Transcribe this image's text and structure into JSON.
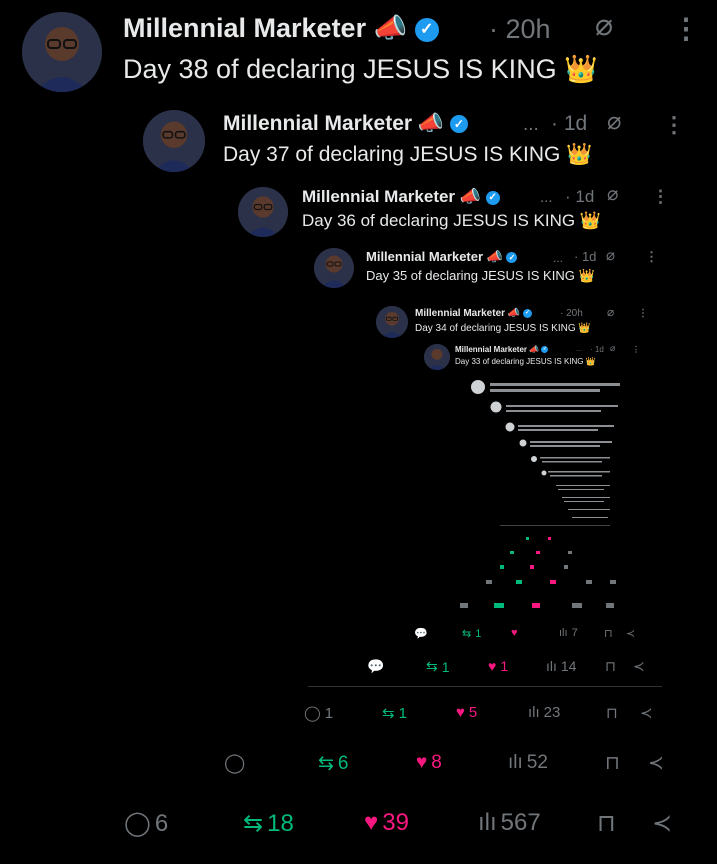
{
  "posts": [
    {
      "name": "Millennial Marketer",
      "time": "· 20h",
      "text": "Day 38 of declaring JESUS IS KING",
      "more": "⋮"
    },
    {
      "name": "Millennial Marketer",
      "ellipsis": "...",
      "time": "· 1d",
      "text": "Day 37 of declaring JESUS IS KING",
      "more": "⋮"
    },
    {
      "name": "Millennial Marketer",
      "ellipsis": "...",
      "time": "· 1d",
      "text": "Day 36 of declaring JESUS IS KING",
      "more": "⋮"
    },
    {
      "name": "Millennial Marketer",
      "ellipsis": "...",
      "time": "· 1d",
      "text": "Day 35 of declaring JESUS IS KING",
      "more": "⋮"
    },
    {
      "name": "Millennial Marketer",
      "time": "· 20h",
      "text": "Day 34 of declaring JESUS IS KING",
      "more": "⋮"
    },
    {
      "name": "Millennial Marketer",
      "ellipsis": "...",
      "time": "· 1d",
      "text": "Day 33 of declaring JESUS IS KING",
      "more": "⋮"
    }
  ],
  "emoji": {
    "megaphone": "📣",
    "crown": "👑",
    "verified": "✓"
  },
  "action_rows": [
    {
      "replies": "",
      "reposts": "1",
      "likes": "",
      "views": "7"
    },
    {
      "replies": "",
      "reposts": "1",
      "likes": "1",
      "views": "14"
    },
    {
      "replies": "1",
      "reposts": "1",
      "likes": "5",
      "views": "23"
    },
    {
      "replies": "",
      "reposts": "6",
      "likes": "8",
      "views": "52"
    },
    {
      "replies": "6",
      "reposts": "18",
      "likes": "39",
      "views": "567"
    }
  ],
  "colors": {
    "background": "#000000",
    "text": "#e7e9ea",
    "muted": "#71767b",
    "verified": "#1d9bf0",
    "repost": "#00ba7c",
    "like": "#f91880"
  }
}
